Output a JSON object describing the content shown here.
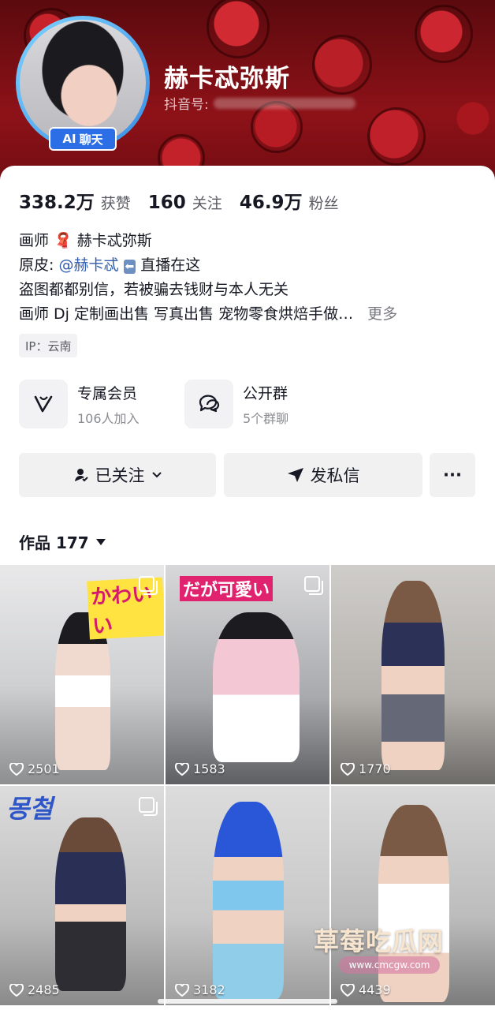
{
  "profile": {
    "nickname": "赫卡忒弥斯",
    "douyin_id_label": "抖音号:",
    "ai_chat_label": "聊天",
    "ai_label": "AI"
  },
  "stats": [
    {
      "value": "338.2万",
      "label": "获赞"
    },
    {
      "value": "160",
      "label": "关注"
    },
    {
      "value": "46.9万",
      "label": "粉丝"
    }
  ],
  "bio": {
    "line1_prefix": "画师",
    "line1_suffix": "赫卡忒弥斯",
    "line2_prefix": "原皮:",
    "line2_mention": "@赫卡忒",
    "line2_suffix": "直播在这",
    "line3": "盗图都都别信，若被骗去钱财与本人无关",
    "line4": "画师 Dj 定制画出售 写真出售 宠物零食烘焙手做…",
    "more": "更多"
  },
  "ip": "IP：云南",
  "features": [
    {
      "title": "专属会员",
      "subtitle": "106人加入",
      "icon": "v-member-icon"
    },
    {
      "title": "公开群",
      "subtitle": "5个群聊",
      "icon": "group-chat-icon"
    }
  ],
  "actions": {
    "following": "已关注",
    "message": "发私信",
    "more": "···"
  },
  "works": {
    "tab_label": "作品 177"
  },
  "grid": [
    {
      "likes": "2501",
      "multi": true,
      "overlay": "かわいい"
    },
    {
      "likes": "1583",
      "multi": true,
      "overlay": "だが可愛い"
    },
    {
      "likes": "1770",
      "multi": false,
      "overlay": ""
    },
    {
      "likes": "2485",
      "multi": true,
      "overlay": "몽철"
    },
    {
      "likes": "3182",
      "multi": false,
      "overlay": ""
    },
    {
      "likes": "4439",
      "multi": false,
      "overlay": ""
    }
  ],
  "watermark": {
    "title": "草莓吃瓜网",
    "url": "www.cmcgw.com"
  }
}
